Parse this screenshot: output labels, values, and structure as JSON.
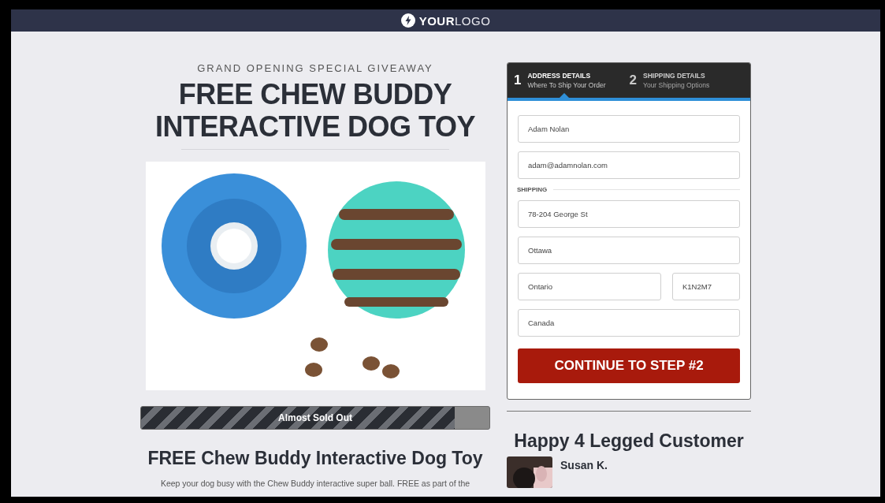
{
  "header": {
    "logo_bold": "YOUR",
    "logo_light": "LOGO"
  },
  "offer": {
    "eyebrow": "GRAND OPENING SPECIAL GIVEAWAY",
    "title_lines": [
      "FREE CHEW BUDDY",
      "INTERACTIVE DOG TOY"
    ],
    "stock_bar": {
      "label": "Almost Sold Out",
      "level": 0.9
    },
    "product_title": "FREE Chew Buddy Interactive Dog Toy",
    "description": "Keep your dog busy with the Chew Buddy interactive super ball. FREE as part of the"
  },
  "form": {
    "steps": [
      {
        "number": "1",
        "title": "ADDRESS DETAILS",
        "subtitle": "Where To Ship Your Order",
        "selected": true
      },
      {
        "number": "2",
        "title": "SHIPPING DETAILS",
        "subtitle": "Your Shipping Options",
        "selected": false
      }
    ],
    "contact_fields": [
      {
        "value": "Adam Nolan"
      },
      {
        "value": "adam@adamnolan.com"
      }
    ],
    "section_label": "SHIPPING",
    "address_rows": [
      [
        {
          "value": "78-204 George St"
        }
      ],
      [
        {
          "value": "Ottawa"
        }
      ],
      [
        {
          "value": "Ontario"
        },
        {
          "value": "K1N2M7"
        }
      ],
      [
        {
          "value": "Canada"
        }
      ]
    ],
    "submit": "CONTINUE TO STEP #2"
  },
  "testimonials": {
    "title": "Happy 4 Legged Customer",
    "items": [
      {
        "name": "Susan K."
      }
    ]
  }
}
